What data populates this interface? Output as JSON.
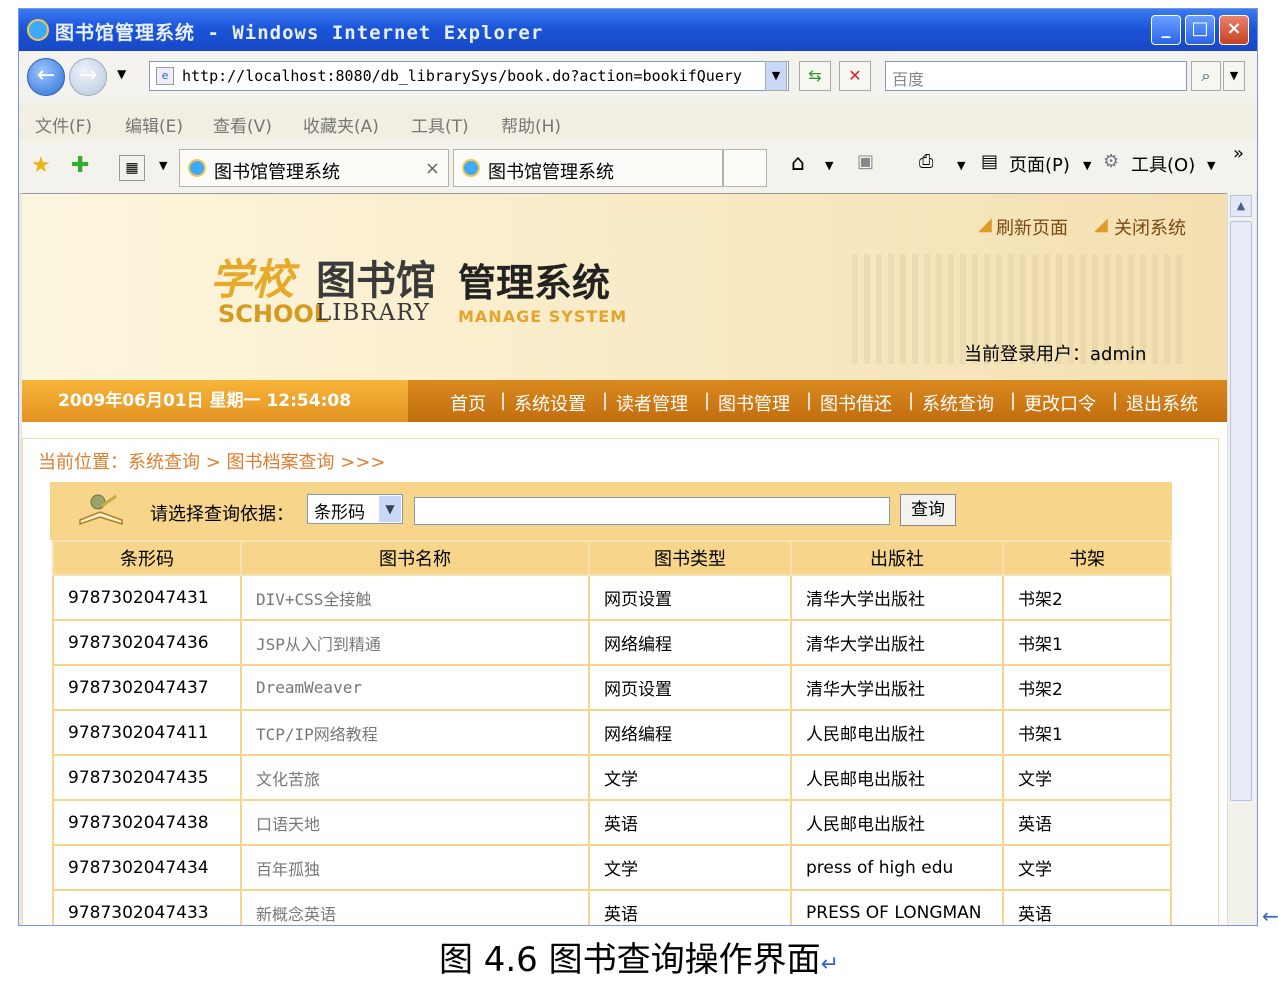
{
  "window": {
    "title": "图书馆管理系统 - Windows Internet Explorer"
  },
  "addressbar": {
    "url": "http://localhost:8080/db_librarySys/book.do?action=bookifQuery",
    "search_placeholder": "百度"
  },
  "menu": [
    "文件(F)",
    "编辑(E)",
    "查看(V)",
    "收藏夹(A)",
    "工具(T)",
    "帮助(H)"
  ],
  "tabs": [
    {
      "label": "图书馆管理系统"
    },
    {
      "label": "图书馆管理系统"
    }
  ],
  "toolbar": {
    "page_label": "页面(P)",
    "tools_label": "工具(O)"
  },
  "banner": {
    "title_cn_1": "学校",
    "title_cn_2": "图书馆",
    "title_cn_3": "管理系统",
    "title_en_1": "SCHOOL",
    "title_en_2": "LIBRARY",
    "title_en_3": "MANAGE SYSTEM",
    "refresh_link": "刷新页面",
    "close_link": "关闭系统",
    "current_user": "当前登录用户：admin"
  },
  "nav": {
    "datetime": "2009年06月01日 星期一 12:54:08",
    "items": [
      "首页",
      "系统设置",
      "读者管理",
      "图书管理",
      "图书借还",
      "系统查询",
      "更改口令",
      "退出系统"
    ]
  },
  "breadcrumb": "当前位置：系统查询 > 图书档案查询 >>>",
  "query": {
    "label": "请选择查询依据：",
    "select_value": "条形码",
    "input_value": "",
    "button_label": "查询"
  },
  "table": {
    "headers": [
      "条形码",
      "图书名称",
      "图书类型",
      "出版社",
      "书架"
    ],
    "rows": [
      [
        "9787302047431",
        "DIV+CSS全接触",
        "网页设置",
        "清华大学出版社",
        "书架2"
      ],
      [
        "9787302047436",
        "JSP从入门到精通",
        "网络编程",
        "清华大学出版社",
        "书架1"
      ],
      [
        "9787302047437",
        "DreamWeaver",
        "网页设置",
        "清华大学出版社",
        "书架2"
      ],
      [
        "9787302047411",
        "TCP/IP网络教程",
        "网络编程",
        "人民邮电出版社",
        "书架1"
      ],
      [
        "9787302047435",
        "文化苦旅",
        "文学",
        "人民邮电出版社",
        "文学"
      ],
      [
        "9787302047438",
        "口语天地",
        "英语",
        "人民邮电出版社",
        "英语"
      ],
      [
        "9787302047434",
        "百年孤独",
        "文学",
        "press of high edu",
        "文学"
      ],
      [
        "9787302047433",
        "新概念英语",
        "英语",
        "PRESS OF LONGMAN",
        "英语"
      ]
    ]
  },
  "caption": "图 4.6  图书查询操作界面"
}
